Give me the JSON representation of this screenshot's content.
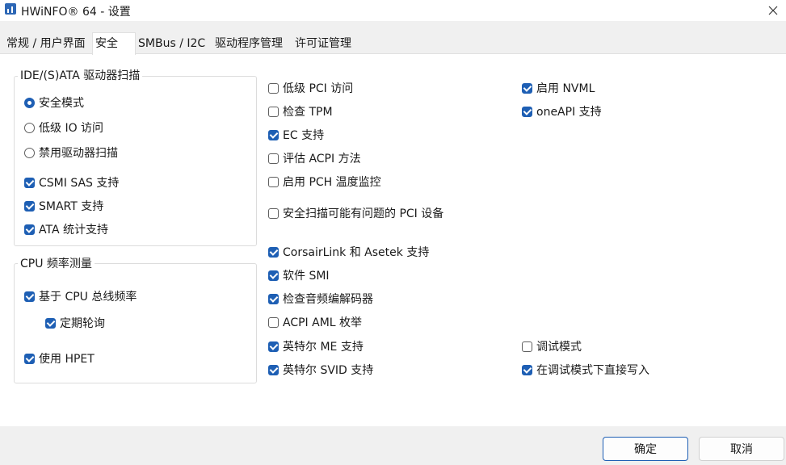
{
  "window": {
    "title": "HWiNFO® 64 - 设置"
  },
  "tabs": [
    {
      "label": "常规 / 用户界面"
    },
    {
      "label": "安全",
      "active": true
    },
    {
      "label": "SMBus / I2C"
    },
    {
      "label": "驱动程序管理"
    },
    {
      "label": "许可证管理"
    }
  ],
  "ide_group": {
    "title": "IDE/(S)ATA 驱动器扫描",
    "radios": [
      {
        "label": "安全模式",
        "selected": true
      },
      {
        "label": "低级 IO 访问",
        "selected": false
      },
      {
        "label": "禁用驱动器扫描",
        "selected": false
      }
    ],
    "checks": [
      {
        "label": "CSMI SAS 支持",
        "checked": true
      },
      {
        "label": "SMART 支持",
        "checked": true
      },
      {
        "label": "ATA 统计支持",
        "checked": true
      }
    ]
  },
  "cpu_group": {
    "title": "CPU 频率测量",
    "checks": [
      {
        "label": "基于 CPU 总线频率",
        "checked": true
      },
      {
        "label": "定期轮询",
        "checked": true
      },
      {
        "label": "使用 HPET",
        "checked": true
      }
    ]
  },
  "middle_options": [
    {
      "label": "低级 PCI 访问",
      "checked": false
    },
    {
      "label": "检查 TPM",
      "checked": false
    },
    {
      "label": "EC 支持",
      "checked": true
    },
    {
      "label": "评估 ACPI 方法",
      "checked": false
    },
    {
      "label": "启用 PCH 温度监控",
      "checked": false
    },
    {
      "label": "安全扫描可能有问题的 PCI 设备",
      "checked": false
    },
    {
      "label": "CorsairLink 和 Asetek 支持",
      "checked": true
    },
    {
      "label": "软件 SMI",
      "checked": true
    },
    {
      "label": "检查音频编解码器",
      "checked": true
    },
    {
      "label": "ACPI AML 枚举",
      "checked": false
    },
    {
      "label": "英特尔 ME 支持",
      "checked": true
    },
    {
      "label": "英特尔 SVID 支持",
      "checked": true
    }
  ],
  "right_options": [
    {
      "label": "启用 NVML",
      "checked": true
    },
    {
      "label": "oneAPI 支持",
      "checked": true
    },
    {
      "label": "调试模式",
      "checked": false
    },
    {
      "label": "在调试模式下直接写入",
      "checked": true
    }
  ],
  "buttons": {
    "ok": "确定",
    "cancel": "取消"
  },
  "colors": {
    "accent": "#1e5fb4",
    "panel": "#ffffff",
    "window": "#f0f0f0"
  }
}
